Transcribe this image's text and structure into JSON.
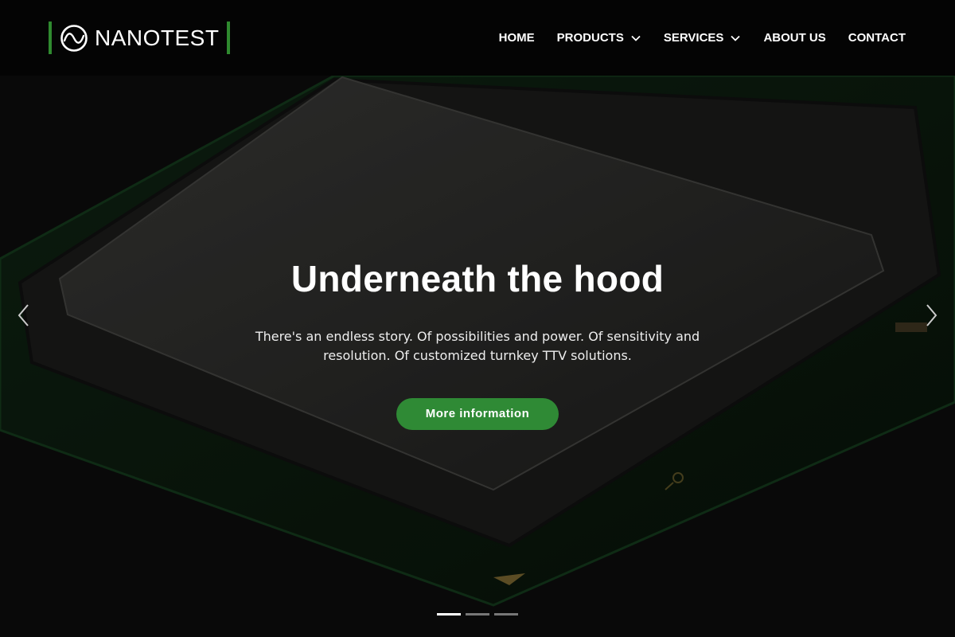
{
  "brand": {
    "name": "NANOTEST",
    "icon": "nanotest-logo-icon",
    "accent": "#2f8a35"
  },
  "nav": {
    "items": [
      {
        "label": "HOME",
        "dropdown": false
      },
      {
        "label": "PRODUCTS",
        "dropdown": true
      },
      {
        "label": "SERVICES",
        "dropdown": true
      },
      {
        "label": "ABOUT US",
        "dropdown": false
      },
      {
        "label": "CONTACT",
        "dropdown": false
      }
    ]
  },
  "hero": {
    "title": "Underneath the hood",
    "text": "There's an endless story. Of possibilities and power. Of sensitivity and resolution. Of customized turnkey TTV solutions.",
    "button_label": "More information",
    "slides": {
      "count": 3,
      "active": 1
    },
    "prev_icon": "chevron-left-icon",
    "next_icon": "chevron-right-icon"
  }
}
